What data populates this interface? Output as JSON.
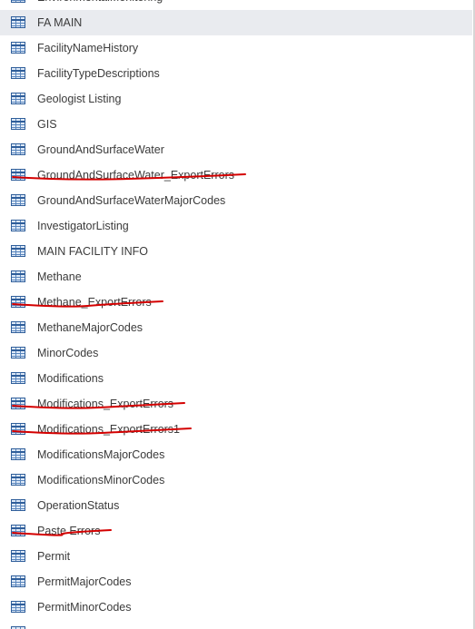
{
  "navigation_pane": {
    "items": [
      {
        "label": "EnvironmentalMonitoring",
        "selected": false,
        "struck": false
      },
      {
        "label": "FA MAIN",
        "selected": true,
        "struck": false
      },
      {
        "label": "FacilityNameHistory",
        "selected": false,
        "struck": false
      },
      {
        "label": "FacilityTypeDescriptions",
        "selected": false,
        "struck": false
      },
      {
        "label": "Geologist Listing",
        "selected": false,
        "struck": false
      },
      {
        "label": "GIS",
        "selected": false,
        "struck": false
      },
      {
        "label": "GroundAndSurfaceWater",
        "selected": false,
        "struck": false
      },
      {
        "label": "GroundAndSurfaceWater_ExportErrors",
        "selected": false,
        "struck": true
      },
      {
        "label": "GroundAndSurfaceWaterMajorCodes",
        "selected": false,
        "struck": false
      },
      {
        "label": "InvestigatorListing",
        "selected": false,
        "struck": false
      },
      {
        "label": "MAIN FACILITY INFO",
        "selected": false,
        "struck": false
      },
      {
        "label": "Methane",
        "selected": false,
        "struck": false
      },
      {
        "label": "Methane_ExportErrors",
        "selected": false,
        "struck": true
      },
      {
        "label": "MethaneMajorCodes",
        "selected": false,
        "struck": false
      },
      {
        "label": "MinorCodes",
        "selected": false,
        "struck": false
      },
      {
        "label": "Modifications",
        "selected": false,
        "struck": false
      },
      {
        "label": "Modifications_ExportErrors",
        "selected": false,
        "struck": true
      },
      {
        "label": "Modifications_ExportErrors1",
        "selected": false,
        "struck": true
      },
      {
        "label": "ModificationsMajorCodes",
        "selected": false,
        "struck": false
      },
      {
        "label": "ModificationsMinorCodes",
        "selected": false,
        "struck": false
      },
      {
        "label": "OperationStatus",
        "selected": false,
        "struck": false
      },
      {
        "label": "Paste Errors",
        "selected": false,
        "struck": true
      },
      {
        "label": "Permit",
        "selected": false,
        "struck": false
      },
      {
        "label": "PermitMajorCodes",
        "selected": false,
        "struck": false
      },
      {
        "label": "PermitMinorCodes",
        "selected": false,
        "struck": false
      },
      {
        "label": "",
        "selected": false,
        "struck": false
      }
    ],
    "item_icon": "table-icon"
  },
  "colors": {
    "selected_row": "#e9ebef",
    "annotation_red": "#d40000",
    "text": "#3b3b3b",
    "icon_blue": "#2f5e9a"
  }
}
